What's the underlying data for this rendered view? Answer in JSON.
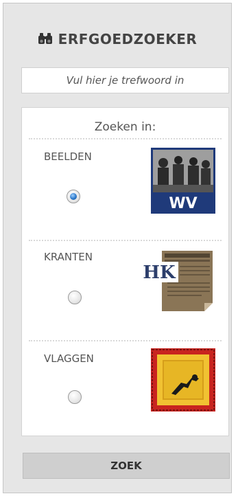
{
  "app": {
    "title": "ERFGOEDZOEKER"
  },
  "search": {
    "placeholder": "Vul hier je trefwoord in"
  },
  "panel": {
    "heading": "Zoeken in:",
    "options": [
      {
        "label": "BEELDEN",
        "selected": true,
        "thumb_text": "WV",
        "thumb_icon": "photo-archive-thumbnail"
      },
      {
        "label": "KRANTEN",
        "selected": false,
        "thumb_text": "HK",
        "thumb_icon": "newspaper-thumbnail"
      },
      {
        "label": "VLAGGEN",
        "selected": false,
        "thumb_icon": "flag-thumbnail"
      }
    ]
  },
  "button": {
    "label": "ZOEK"
  },
  "colors": {
    "widget_bg": "#e6e6e6",
    "panel_bg": "#ffffff",
    "text": "#555555",
    "title": "#444444",
    "radio_selected": "#2d78c8",
    "wv_blue": "#1f3a7a",
    "flag_red": "#c8241f",
    "flag_yellow": "#f1c232"
  }
}
